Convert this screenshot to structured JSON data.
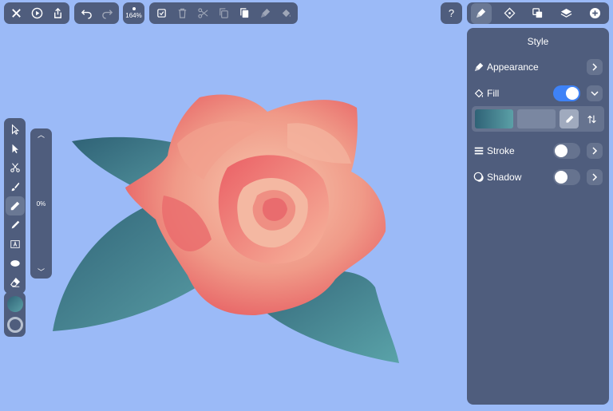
{
  "toolbar": {
    "zoom_label": "164%",
    "help_label": "?"
  },
  "opacity_slider": {
    "value_label": "0%"
  },
  "panel": {
    "title": "Style",
    "rows": {
      "appearance": "Appearance",
      "fill": "Fill",
      "stroke": "Stroke",
      "shadow": "Shadow"
    },
    "fill_enabled": true,
    "stroke_enabled": false,
    "shadow_enabled": false
  },
  "colors": {
    "canvas_bg": "#9bbaf7",
    "panel_bg": "#4f5d7d",
    "toggle_on": "#3e82f7",
    "rose_light": "#f5b7a0",
    "rose_dark": "#e9585e",
    "leaf_light": "#5ba0a7",
    "leaf_dark": "#2f6276"
  },
  "icons": {
    "tools": [
      "node-select-icon",
      "select-icon",
      "scissors-icon",
      "brush-icon",
      "pen-icon",
      "pencil-icon",
      "text-icon",
      "ellipse-icon",
      "eraser-icon"
    ],
    "panel_tabs": [
      "brush-style-icon",
      "transform-icon",
      "arrange-icon",
      "layers-icon",
      "add-icon"
    ]
  }
}
